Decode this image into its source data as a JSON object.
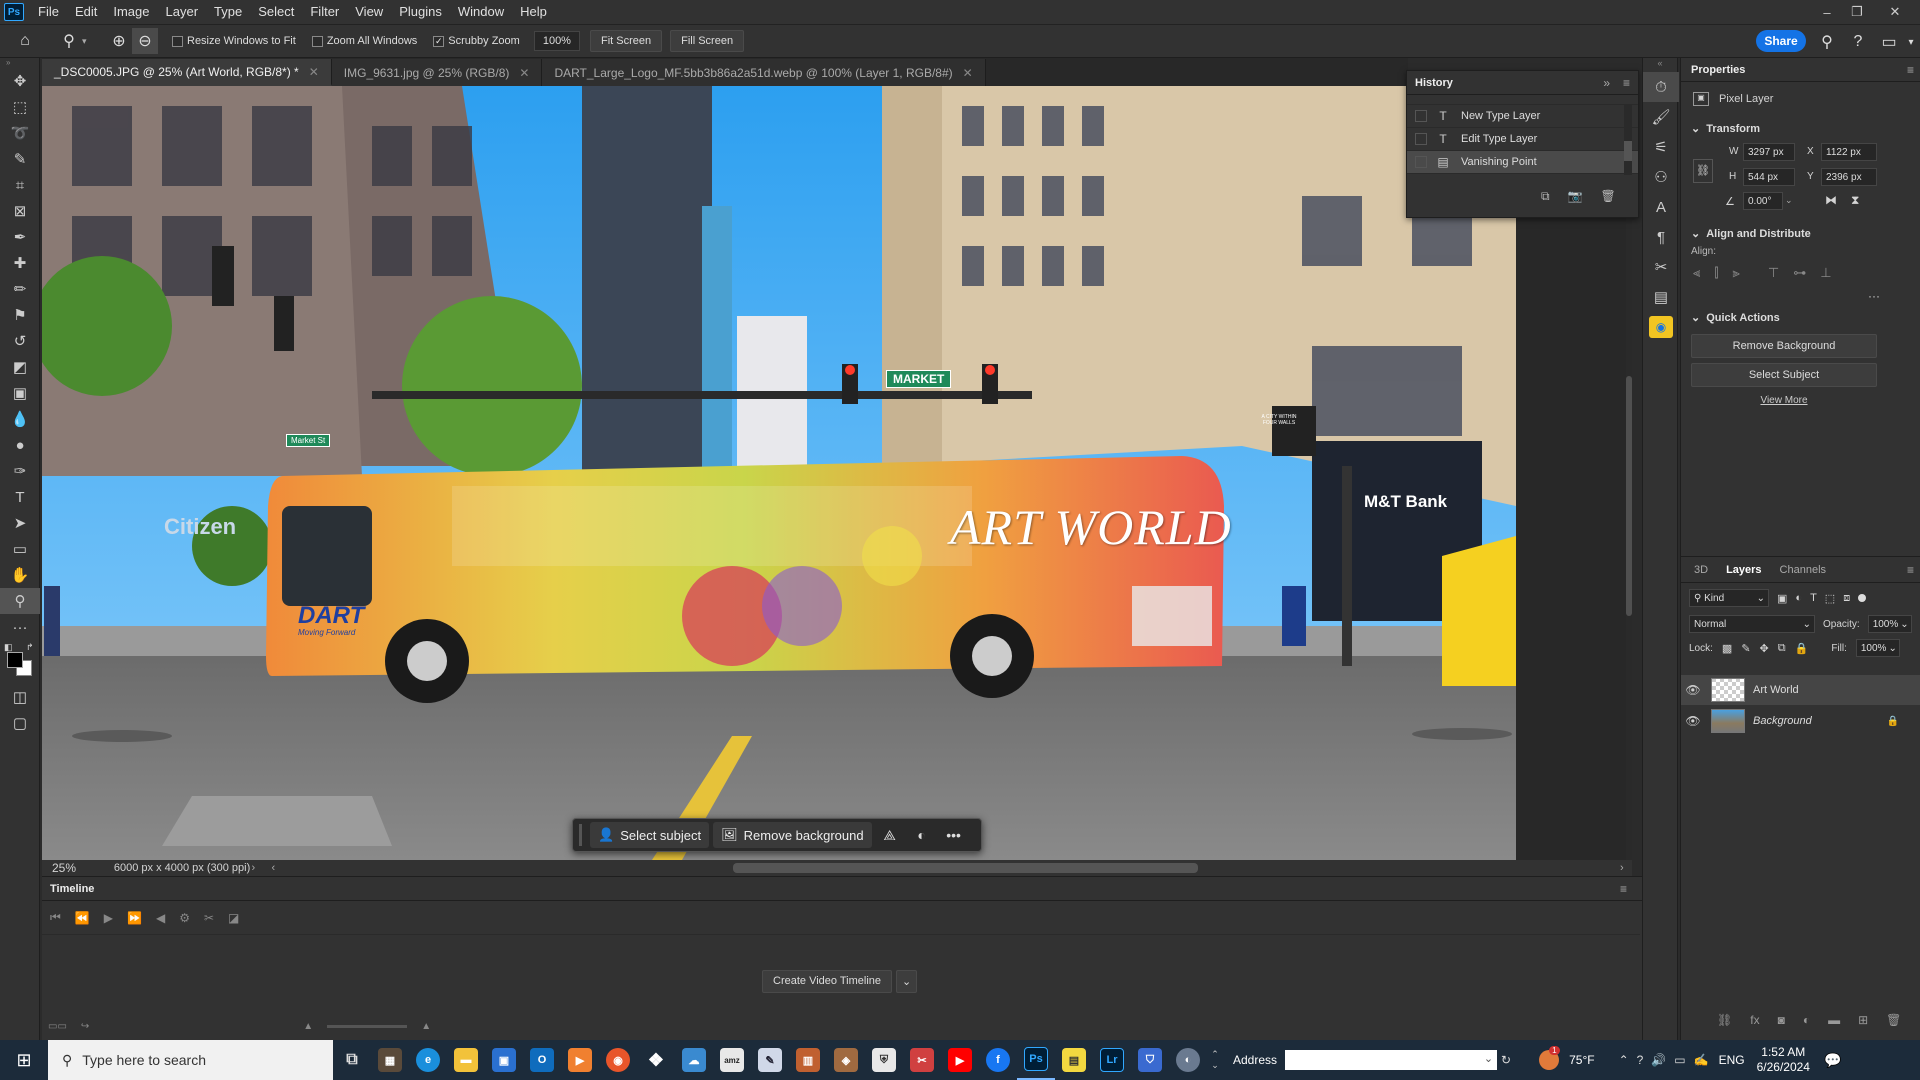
{
  "app": {
    "logo": "Ps"
  },
  "menu": [
    "File",
    "Edit",
    "Image",
    "Layer",
    "Type",
    "Select",
    "Filter",
    "View",
    "Plugins",
    "Window",
    "Help"
  ],
  "options": {
    "resize_windows": "Resize Windows to Fit",
    "zoom_all": "Zoom All Windows",
    "scrubby_zoom": "Scrubby Zoom",
    "zoom_value": "100%",
    "fit_screen": "Fit Screen",
    "fill_screen": "Fill Screen",
    "share": "Share"
  },
  "tabs": [
    {
      "label": "_DSC0005.JPG @ 25% (Art World, RGB/8*) *",
      "active": true
    },
    {
      "label": "IMG_9631.jpg @ 25% (RGB/8)",
      "active": false
    },
    {
      "label": "DART_Large_Logo_MF.5bb3b86a2a51d.webp @ 100% (Layer 1, RGB/8#)",
      "active": false
    }
  ],
  "photo_text": {
    "art_world": "ART WORLD",
    "market": "MARKET",
    "citizens": "Citizen",
    "mt_bank": "M&T Bank",
    "dart": "DART",
    "dart_sub": "Moving Forward",
    "market_street_small": "Market St",
    "plaque": "A CITY WITHIN FOUR WALLS"
  },
  "context_bar": {
    "select_subject": "Select subject",
    "remove_background": "Remove background",
    "more": "•••"
  },
  "status": {
    "zoom": "25%",
    "doc_size": "6000 px x 4000 px (300 ppi)"
  },
  "timeline": {
    "title": "Timeline",
    "create_button": "Create Video Timeline"
  },
  "history": {
    "title": "History",
    "items": [
      {
        "label": "New Type Layer",
        "icon": "T"
      },
      {
        "label": "Edit Type Layer",
        "icon": "T"
      },
      {
        "label": "Vanishing Point",
        "icon": "▤"
      }
    ]
  },
  "properties": {
    "title": "Properties",
    "kind": "Pixel Layer",
    "transform_title": "Transform",
    "w_label": "W",
    "w": "3297 px",
    "h_label": "H",
    "h": "544 px",
    "x_label": "X",
    "x": "1122 px",
    "y_label": "Y",
    "y": "2396 px",
    "angle": "0.00°",
    "align_title": "Align and Distribute",
    "align_label": "Align:",
    "quick_title": "Quick Actions",
    "remove_bg": "Remove Background",
    "select_subject": "Select Subject",
    "view_more": "View More"
  },
  "layers_panel": {
    "tabs": [
      {
        "label": "3D",
        "active": false
      },
      {
        "label": "Layers",
        "active": true
      },
      {
        "label": "Channels",
        "active": false
      }
    ],
    "kind": "Kind",
    "blend": "Normal",
    "opacity_label": "Opacity:",
    "opacity": "100%",
    "lock_label": "Lock:",
    "fill_label": "Fill:",
    "fill": "100%",
    "layers": [
      {
        "name": "Art World",
        "selected": true
      },
      {
        "name": "Background",
        "selected": false
      }
    ]
  },
  "taskbar": {
    "search_placeholder": "Type here to search",
    "address_label": "Address",
    "weather": "75°F",
    "lang": "ENG",
    "time": "1:52 AM",
    "date": "6/26/2024",
    "weather_badge": "1"
  },
  "colors": {
    "accent": "#1473e6",
    "ps_blue": "#31a8ff"
  }
}
